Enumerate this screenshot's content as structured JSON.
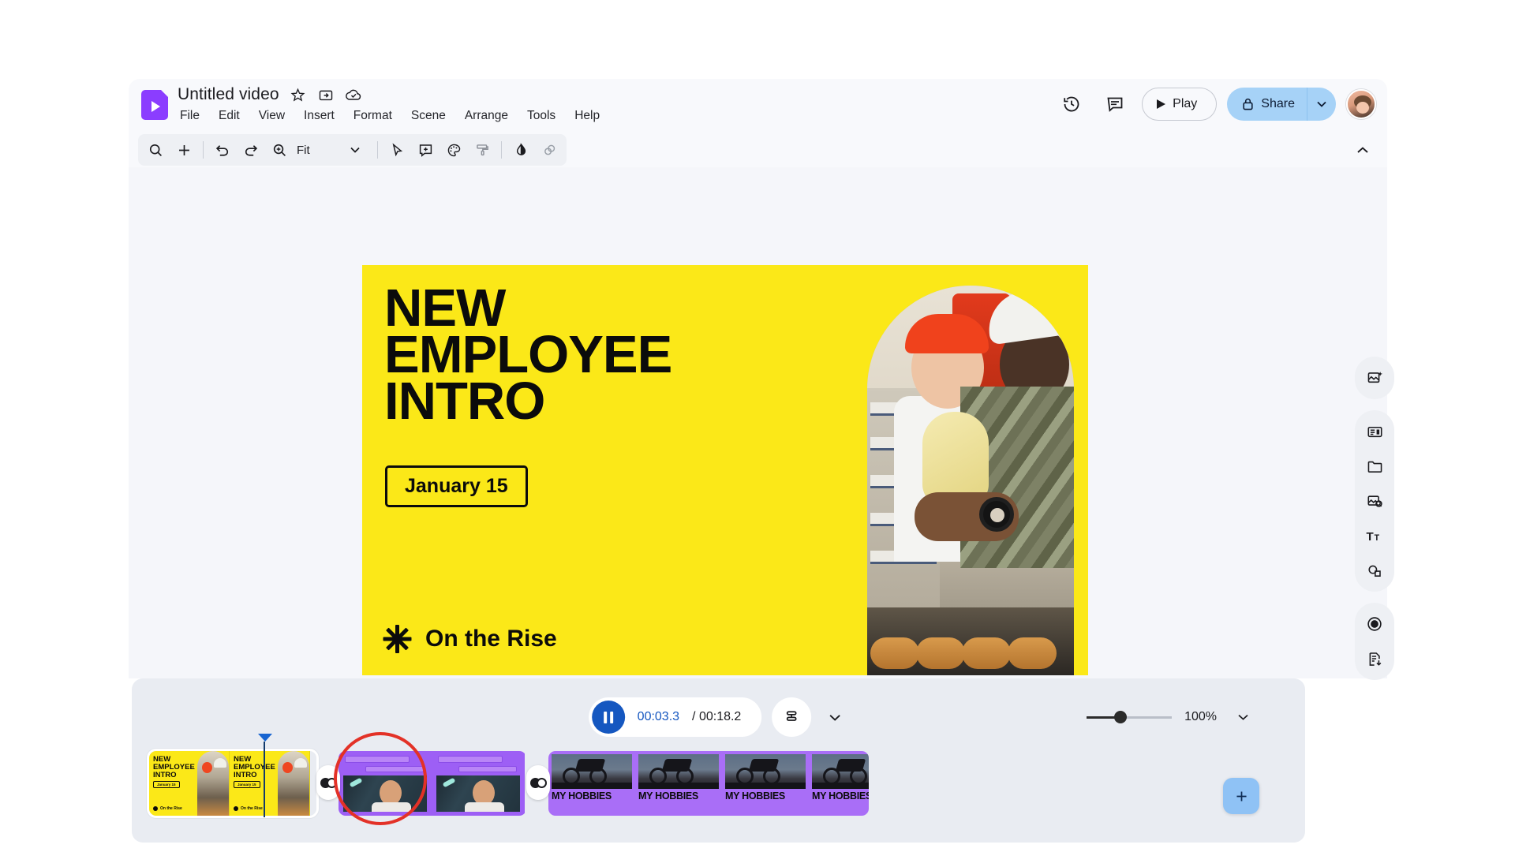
{
  "header": {
    "doc_title": "Untitled video",
    "logo_name": "google-vids-logo",
    "title_icons": [
      "star-icon",
      "move-to-folder-icon",
      "cloud-saved-icon"
    ],
    "menus": [
      "File",
      "Edit",
      "View",
      "Insert",
      "Format",
      "Scene",
      "Arrange",
      "Tools",
      "Help"
    ],
    "history_icon": "version-history-icon",
    "comment_icon": "comment-icon",
    "play_label": "Play",
    "share_label": "Share",
    "share_lock_icon": "lock-icon",
    "avatar_name": "user-avatar"
  },
  "toolbar": {
    "items": [
      {
        "name": "search-icon"
      },
      {
        "name": "add-icon"
      },
      {
        "name": "undo-icon"
      },
      {
        "name": "redo-icon"
      },
      {
        "name": "zoom-in-icon"
      }
    ],
    "zoom_fit_label": "Fit",
    "tools": [
      {
        "name": "select-cursor-icon"
      },
      {
        "name": "add-comment-icon"
      },
      {
        "name": "color-palette-icon"
      },
      {
        "name": "format-paint-icon"
      },
      {
        "name": "fill-color-icon"
      },
      {
        "name": "shape-blur-icon"
      }
    ],
    "collapse_icon": "chevron-up-icon"
  },
  "slide": {
    "title_lines": [
      "NEW",
      "EMPLOYEE",
      "INTRO"
    ],
    "date_badge": "January 15",
    "footer_text": "On the Rise",
    "footer_icon": "asterisk-star-icon",
    "background_color": "#fbe818",
    "text_color": "#0b0b0b",
    "photo_name": "employee-photo"
  },
  "rail": {
    "groups": [
      [
        {
          "name": "generate-media-icon"
        }
      ],
      [
        {
          "name": "templates-icon"
        },
        {
          "name": "folder-icon"
        },
        {
          "name": "stock-media-icon"
        },
        {
          "name": "text-icon"
        },
        {
          "name": "shapes-icon"
        }
      ],
      [
        {
          "name": "record-icon"
        },
        {
          "name": "export-icon"
        }
      ]
    ]
  },
  "timeline": {
    "pause_icon": "pause-icon",
    "current_time": "00:03.3",
    "total_time": "/ 00:18.2",
    "scenes_icon": "scenes-list-icon",
    "expand_icon": "chevron-down-icon",
    "zoom_percent": "100%",
    "zoom_caret_icon": "chevron-down-icon",
    "zoom_slider_value": 40,
    "add_clip_icon": "add-clip-icon",
    "playhead_name": "playhead",
    "annotation_name": "red-circle-annotation",
    "clips": [
      {
        "name": "clip-title-slide",
        "selected": true,
        "kind": "title",
        "frame_title": "NEW\nEMPLOYEE\nINTRO",
        "frame_date": "January 15",
        "frame_footer": "On the Rise",
        "frames": 3
      },
      {
        "name": "clip-interview",
        "selected": false,
        "kind": "interview",
        "frames": 3
      },
      {
        "name": "clip-my-hobbies",
        "selected": false,
        "kind": "hobbies",
        "caption": "MY HOBBIES",
        "frames": 4
      }
    ],
    "transitions": [
      {
        "name": "transition-marker"
      },
      {
        "name": "transition-marker"
      }
    ]
  },
  "colors": {
    "accent_blue": "#1557c0",
    "share_blue": "#a6d2f7",
    "slide_yellow": "#fbe818",
    "clip_purple": "#9d5ff5",
    "annotation_red": "#e33127"
  }
}
